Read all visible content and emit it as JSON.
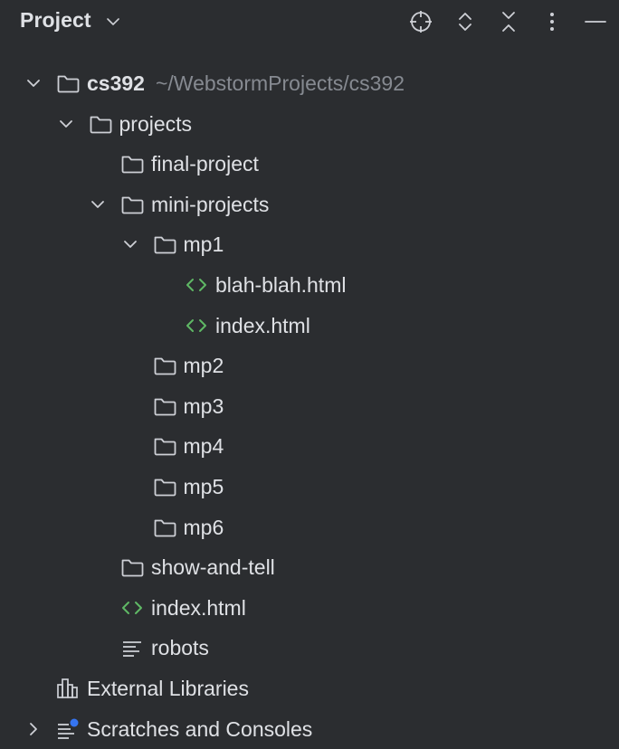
{
  "header": {
    "title": "Project",
    "tools": [
      {
        "icon": "locate-icon"
      },
      {
        "icon": "expand-all-icon"
      },
      {
        "icon": "collapse-all-icon"
      },
      {
        "icon": "more-options-icon"
      },
      {
        "icon": "hide-icon"
      }
    ]
  },
  "tree": [
    {
      "label": "cs392",
      "hint": "~/WebstormProjects/cs392",
      "icon": "folder-icon",
      "level": 0,
      "arrow": "expanded",
      "bold": true
    },
    {
      "label": "projects",
      "icon": "folder-icon",
      "level": 1,
      "arrow": "expanded"
    },
    {
      "label": "final-project",
      "icon": "folder-icon",
      "level": 2,
      "arrow": "none"
    },
    {
      "label": "mini-projects",
      "icon": "folder-icon",
      "level": 2,
      "arrow": "expanded"
    },
    {
      "label": "mp1",
      "icon": "folder-icon",
      "level": 3,
      "arrow": "expanded"
    },
    {
      "label": "blah-blah.html",
      "icon": "html-file-icon",
      "level": 4,
      "arrow": "none"
    },
    {
      "label": "index.html",
      "icon": "html-file-icon",
      "level": 4,
      "arrow": "none"
    },
    {
      "label": "mp2",
      "icon": "folder-icon",
      "level": 3,
      "arrow": "none"
    },
    {
      "label": "mp3",
      "icon": "folder-icon",
      "level": 3,
      "arrow": "none"
    },
    {
      "label": "mp4",
      "icon": "folder-icon",
      "level": 3,
      "arrow": "none"
    },
    {
      "label": "mp5",
      "icon": "folder-icon",
      "level": 3,
      "arrow": "none"
    },
    {
      "label": "mp6",
      "icon": "folder-icon",
      "level": 3,
      "arrow": "none"
    },
    {
      "label": "show-and-tell",
      "icon": "folder-icon",
      "level": 2,
      "arrow": "none"
    },
    {
      "label": "index.html",
      "icon": "html-file-icon",
      "level": 2,
      "arrow": "none"
    },
    {
      "label": "robots",
      "icon": "text-file-icon",
      "level": 2,
      "arrow": "none"
    },
    {
      "label": "External Libraries",
      "icon": "libraries-icon",
      "level": 0,
      "arrow": "none"
    },
    {
      "label": "Scratches and Consoles",
      "icon": "scratches-icon",
      "level": 0,
      "arrow": "collapsed"
    }
  ],
  "colors": {
    "background": "#2b2d30",
    "text": "#dfe1e5",
    "hint": "#868a91",
    "icon": "#ced0d6",
    "html_icon": "#5fb865",
    "badge": "#3574f0"
  }
}
